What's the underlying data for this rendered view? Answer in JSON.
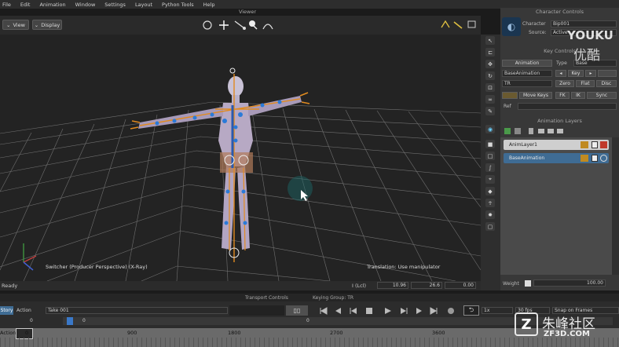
{
  "menu": [
    "File",
    "Edit",
    "Animation",
    "Window",
    "Settings",
    "Layout",
    "Python Tools",
    "Help"
  ],
  "viewer": {
    "title": "Viewer",
    "view_button": "View",
    "display_button": "Display",
    "view_label": "Switcher (Producer Perspective) (X-Ray)",
    "manipulator_label": "Translation: Use manipulator"
  },
  "status": {
    "ready": "Ready",
    "layer": "I (Lcl)",
    "x_value": "10.96",
    "y_value": "26.6",
    "z_value": "0.00"
  },
  "character_controls": {
    "title": "Character Controls",
    "character_label": "Character",
    "character_value": "Bip001",
    "source_label": "Source:",
    "source_value": "Active"
  },
  "key_controls": {
    "title": "Key Controls",
    "animation_button": "Animation",
    "type_label": "Type",
    "type_value": "Base",
    "take_value": "BaseAnimation",
    "key_button": "Key",
    "mode_value": "TR",
    "zero_button": "Zero",
    "flat_button": "Flat",
    "disc_button": "Disc",
    "move_keys_button": "Move Keys",
    "fk_button": "FK",
    "ik_button": "IK",
    "sync_button": "Sync",
    "ref_label": "Ref"
  },
  "animation_layers": {
    "title": "Animation Layers",
    "layers": [
      "AnimLayer1",
      "BaseAnimation"
    ],
    "weight_label": "Weight",
    "weight_value": "100.00"
  },
  "transport": {
    "title": "Transport Controls",
    "keying_group": "Keying Group: TR",
    "story_button": "Story",
    "action_label": "Action",
    "take_value": "Take 001",
    "frame_left": "0",
    "frame_mid": "0",
    "frame_right": "0",
    "speed": "1x",
    "fps": "30 fps",
    "snap": "Snap on Frames",
    "ruler_label": "Action",
    "ruler_ticks": [
      "0",
      "900",
      "1800",
      "2700",
      "3600"
    ]
  },
  "watermarks": {
    "youku_en": "YOUKU",
    "youku_cn": "优酷",
    "zf3d_cn": "朱峰社区",
    "zf3d_en": "ZF3D.COM"
  },
  "colors": {
    "selected_layer": "#3f6c94",
    "layer_row": "#cfcfcf",
    "accent_orange": "#e08a20",
    "close_red": "#c0392b"
  }
}
